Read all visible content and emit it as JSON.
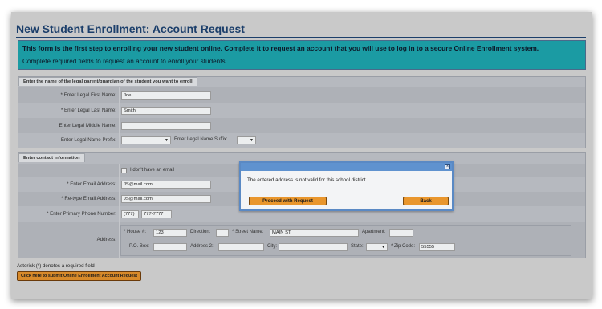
{
  "page": {
    "title": "New Student Enrollment: Account Request"
  },
  "info": {
    "line1": "This form is the first step to enrolling your new student online. Complete it to request an account that you will use to log in to a secure Online Enrollment system.",
    "line2": "Complete required fields to request an account to enroll your students."
  },
  "guardian": {
    "tab": "Enter the name of the legal parent/guardian of the student you want to enroll",
    "first_label": "* Enter Legal First Name:",
    "first_value": "Joe",
    "last_label": "* Enter Legal Last Name:",
    "last_value": "Smith",
    "middle_label": "Enter Legal Middle Name:",
    "middle_value": "",
    "prefix_label": "Enter Legal Name Prefix:",
    "suffix_label": "Enter Legal Name Suffix:"
  },
  "contact": {
    "tab": "Enter contact information",
    "no_email_label": "I don't have an email",
    "email_label": "* Enter Email Address:",
    "email_value": "JS@mail.com",
    "retype_label": "* Re-type Email Address:",
    "retype_value": "JS@mail.com",
    "phone_label": "* Enter Primary Phone Number:",
    "phone_area": "(777)",
    "phone_number": "777-7777",
    "address_label": "Address:",
    "house_label": "* House #:",
    "house_value": "123",
    "direction_label": "Direction:",
    "street_label": "* Street Name:",
    "street_value": "MAIN ST",
    "apartment_label": "Apartment:",
    "pobox_label": "P.O. Box:",
    "address2_label": "Address 2:",
    "city_label": "City:",
    "state_label": "State:",
    "zip_label": "* Zip Code:",
    "zip_value": "55555"
  },
  "footer": {
    "note": "Asterisk (*) denotes a required field",
    "submit_label": "Click here to submit Online Enrollment Account Request"
  },
  "dialog": {
    "close_glyph": "×",
    "message": "The entered address is not valid for this school district.",
    "proceed_label": "Proceed with Request",
    "back_label": "Back"
  }
}
